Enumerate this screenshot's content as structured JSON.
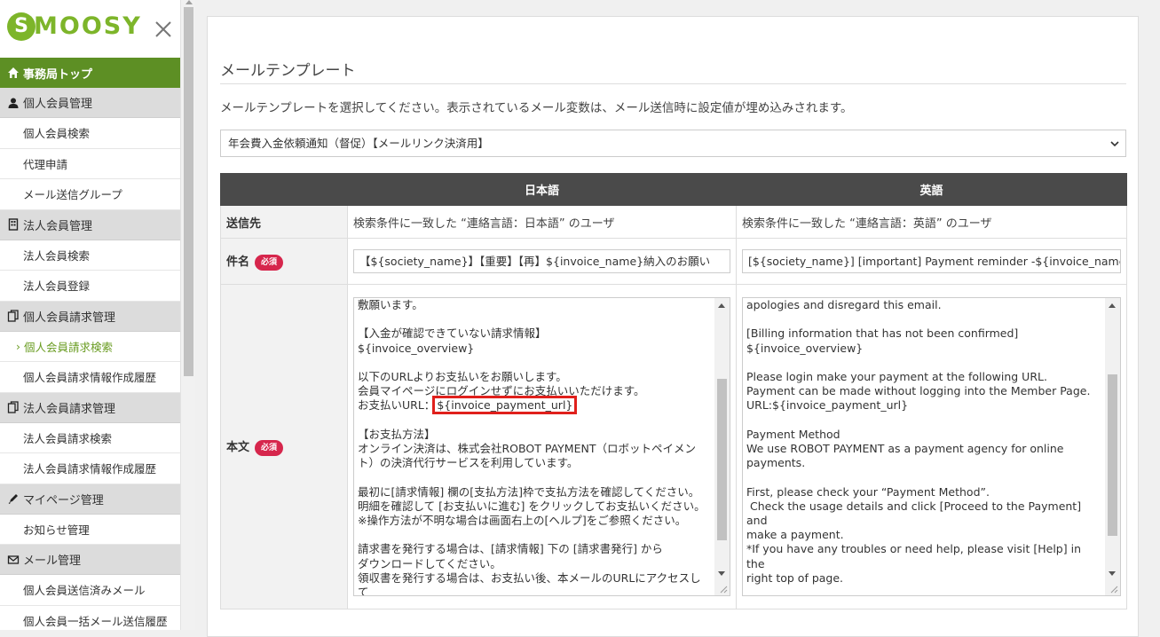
{
  "brand": {
    "logo_letter": "S",
    "logo_text": "MOOSY"
  },
  "sidebar": {
    "top": "事務局トップ",
    "sections": [
      {
        "title": "個人会員管理",
        "icon": "person-icon",
        "items": [
          {
            "label": "個人会員検索"
          },
          {
            "label": "代理申請"
          },
          {
            "label": "メール送信グループ"
          }
        ]
      },
      {
        "title": "法人会員管理",
        "icon": "building-icon",
        "items": [
          {
            "label": "法人会員検索"
          },
          {
            "label": "法人会員登録"
          }
        ]
      },
      {
        "title": "個人会員請求管理",
        "icon": "documents-icon",
        "items": [
          {
            "label": "個人会員請求検索",
            "active": true
          },
          {
            "label": "個人会員請求情報作成履歴"
          }
        ]
      },
      {
        "title": "法人会員請求管理",
        "icon": "documents-icon",
        "items": [
          {
            "label": "法人会員請求検索"
          },
          {
            "label": "法人会員請求情報作成履歴"
          }
        ]
      },
      {
        "title": "マイページ管理",
        "icon": "pencil-icon",
        "items": [
          {
            "label": "お知らせ管理"
          }
        ]
      },
      {
        "title": "メール管理",
        "icon": "envelope-icon",
        "items": [
          {
            "label": "個人会員送信済みメール"
          },
          {
            "label": "個人会員一括メール送信履歴"
          }
        ]
      }
    ],
    "active_prefix": "›"
  },
  "main": {
    "title": "メールテンプレート",
    "instruction": "メールテンプレートを選択してください。表示されているメール変数は、メール送信時に設定値が埋め込みされます。",
    "template_selected": "年会費入金依頼通知（督促）【メールリンク決済用】",
    "table": {
      "headers": {
        "blank": "",
        "ja": "日本語",
        "en": "英語"
      },
      "recipient": {
        "label": "送信先",
        "ja": "検索条件に一致した “連絡言語：日本語” のユーザ",
        "en": "検索条件に一致した “連絡言語：英語” のユーザ"
      },
      "subject": {
        "label": "件名",
        "required": "必須",
        "ja": "【${society_name}】【重要】【再】${invoice_name}納入のお願い",
        "en": "[${society_name}] [important] Payment reminder -${invoice_name}"
      },
      "body": {
        "label": "本文",
        "required": "必須",
        "ja_before": "敷願います。\n\n【入金が確認できていない請求情報】\n${invoice_overview}\n\n以下のURLよりお支払いをお願いします。\n会員マイページにログインせずにお支払いいただけます。\nお支払いURL：",
        "ja_highlight": "${invoice_payment_url}",
        "ja_after": "\n\n【お支払方法】\nオンライン決済は、株式会社ROBOT PAYMENT（ロボットペイメン\nト）の決済代行サービスを利用しています。\n\n最初に[請求情報] 欄の[支払方法]枠で支払方法を確認してください。\n明細を確認して [お支払いに進む] をクリックしてお支払いください。\n※操作方法が不明な場合は画面右上の[ヘルプ]をご参照ください。\n\n請求書を発行する場合は、[請求情報] 下の [請求書発行] から\nダウンロードしてください。\n領収書を発行する場合は、お支払い後、本メールのURLにアクセスし\nて",
        "en": "apologies and disregard this email.\n\n[Billing information that has not been confirmed]\n${invoice_overview}\n\nPlease login make your payment at the following URL.\nPayment can be made without logging into the Member Page.\nURL:${invoice_payment_url}\n\nPayment Method\nWe use ROBOT PAYMENT as a payment agency for online\npayments.\n\nFirst, please check your “Payment Method”.\n Check the usage details and click [Proceed to the Payment] and\nmake a payment.\n*If you have any troubles or need help, please visit [Help] in the\nright top of page.\n\nIf you need to issue an invoice, please download from the [Issue\nan Invoice] link."
      }
    }
  },
  "colors": {
    "brand_green": "#7db52a",
    "nav_green": "#5d8f24",
    "required_red": "#d6264c",
    "highlight_red": "#e0201c"
  }
}
